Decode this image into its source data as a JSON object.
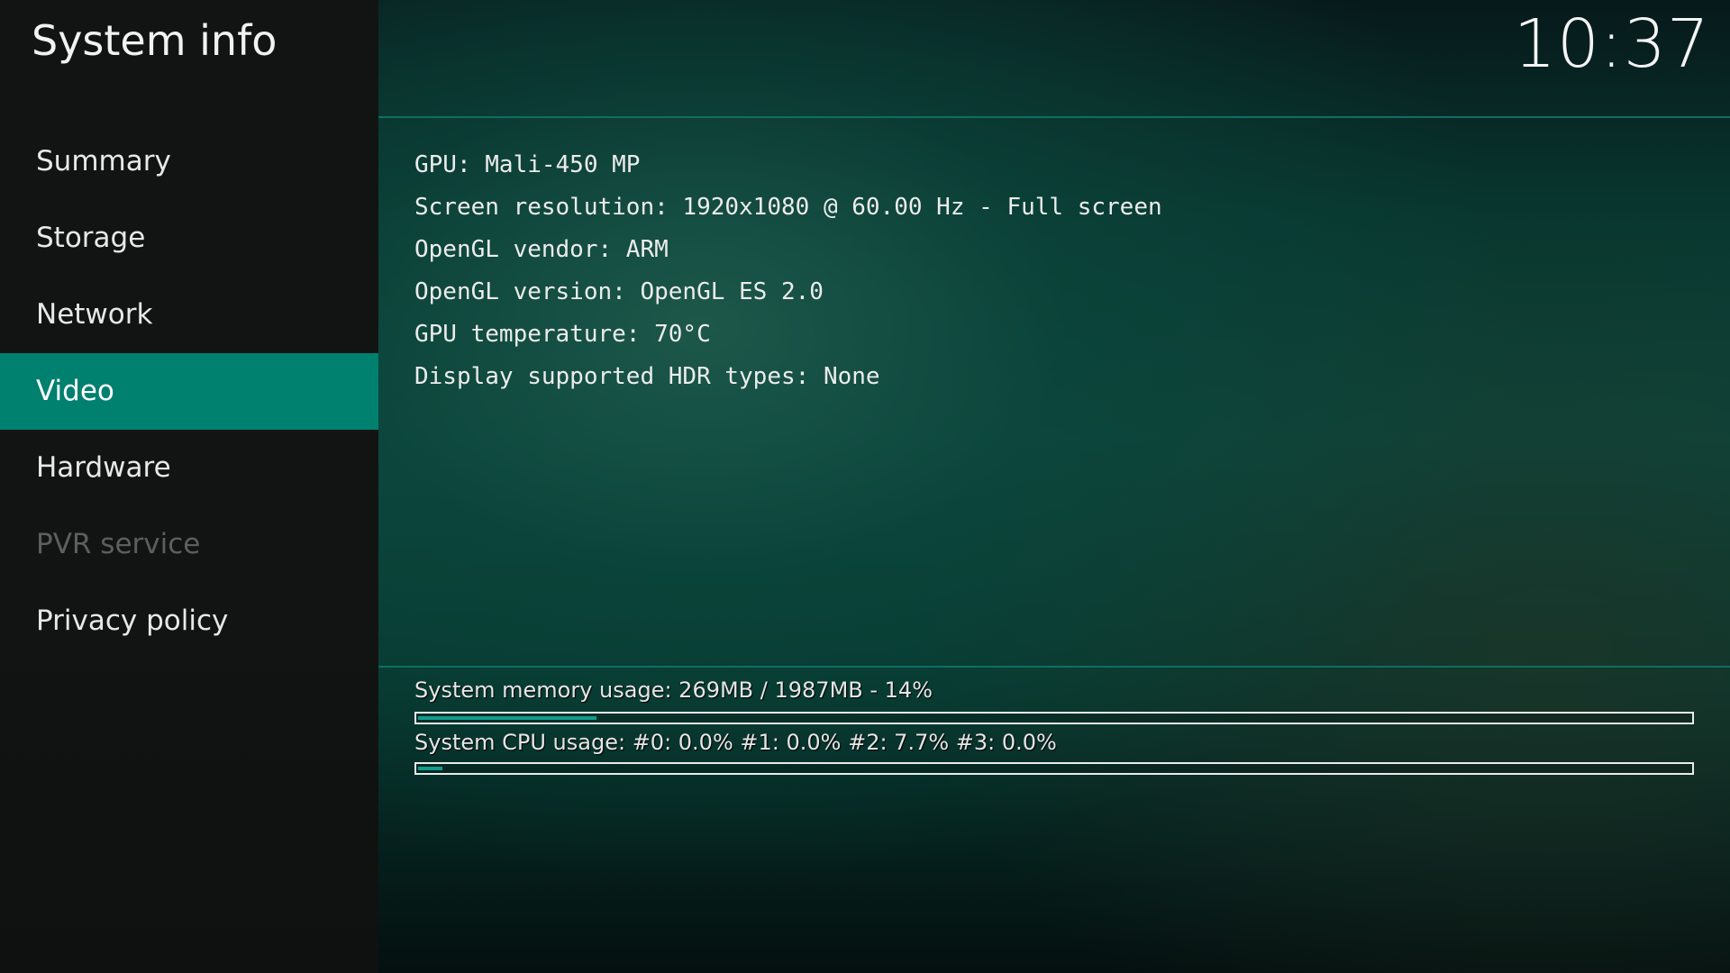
{
  "sidebar": {
    "title": "System info",
    "items": [
      {
        "label": "Summary",
        "state": "normal"
      },
      {
        "label": "Storage",
        "state": "normal"
      },
      {
        "label": "Network",
        "state": "normal"
      },
      {
        "label": "Video",
        "state": "active"
      },
      {
        "label": "Hardware",
        "state": "normal"
      },
      {
        "label": "PVR service",
        "state": "disabled"
      },
      {
        "label": "Privacy policy",
        "state": "normal"
      }
    ]
  },
  "header": {
    "clock": "10:37"
  },
  "info": {
    "lines": [
      "GPU: Mali-450 MP",
      "Screen resolution: 1920x1080 @ 60.00 Hz - Full screen",
      "OpenGL vendor: ARM",
      "OpenGL version: OpenGL ES 2.0",
      "GPU temperature: 70°C",
      "Display supported HDR types: None"
    ]
  },
  "usage": {
    "memory_label": "System memory usage: 269MB / 1987MB - 14%",
    "memory_percent": 14,
    "cpu_label": "System CPU usage: #0: 0.0% #1: 0.0% #2: 7.7% #3: 0.0%",
    "cpu_percent": 1.9
  },
  "colors": {
    "accent": "#00806f",
    "divider": "#0f6e62",
    "bar_fill": "#129c8c"
  }
}
